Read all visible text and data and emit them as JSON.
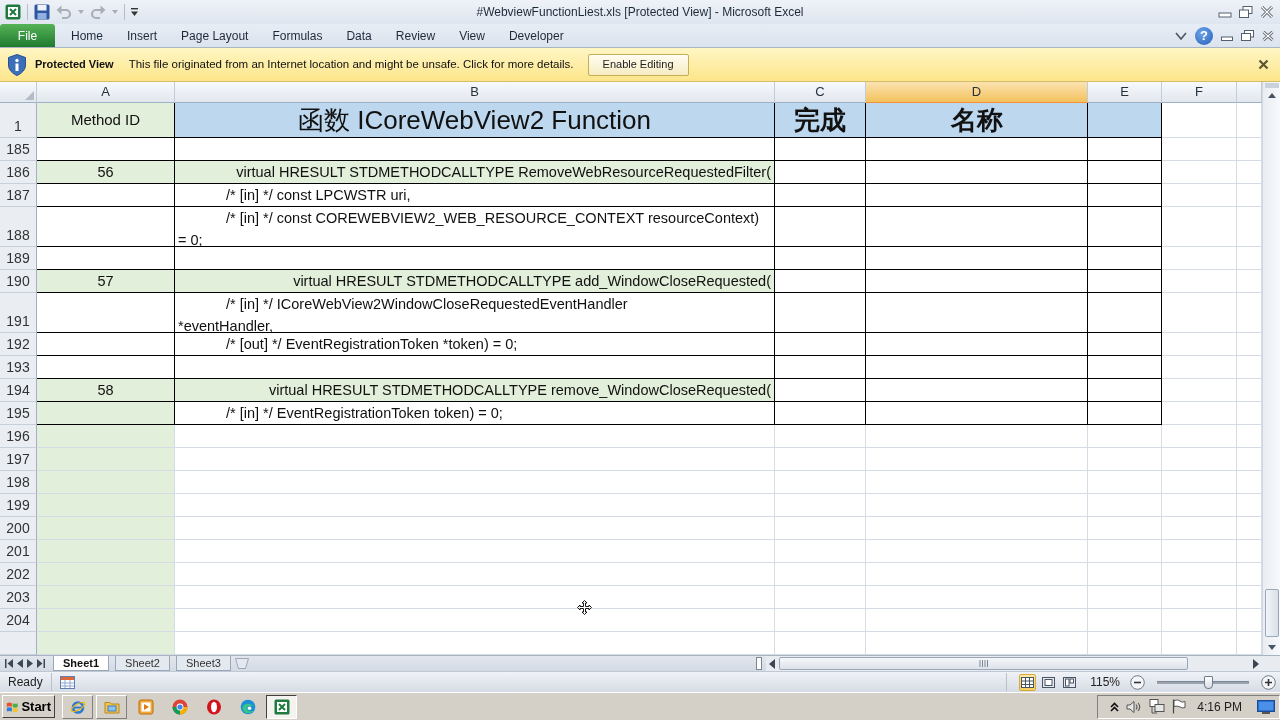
{
  "window": {
    "title": "#WebviewFunctionLiest.xls [Protected View] - Microsoft Excel"
  },
  "quick_access": [
    {
      "kind": "save",
      "disabled": false
    },
    {
      "kind": "undo",
      "disabled": true
    },
    {
      "kind": "redo",
      "disabled": true
    }
  ],
  "ribbon": {
    "tabs": [
      {
        "label": "File",
        "kind": "backstage"
      },
      {
        "label": "Home",
        "kind": "tab"
      },
      {
        "label": "Insert",
        "kind": "tab"
      },
      {
        "label": "Page Layout",
        "kind": "tab"
      },
      {
        "label": "Formulas",
        "kind": "tab"
      },
      {
        "label": "Data",
        "kind": "tab"
      },
      {
        "label": "Review",
        "kind": "tab"
      },
      {
        "label": "View",
        "kind": "tab"
      },
      {
        "label": "Developer",
        "kind": "tab"
      }
    ],
    "help": "?"
  },
  "message_bar": {
    "title": "Protected View",
    "message": "This file originated from an Internet location and might be unsafe. Click for more details.",
    "button": "Enable Editing"
  },
  "columns": [
    {
      "label": "A",
      "selected": false
    },
    {
      "label": "B",
      "selected": false
    },
    {
      "label": "C",
      "selected": false
    },
    {
      "label": "D",
      "selected": true
    },
    {
      "label": "E",
      "selected": false
    },
    {
      "label": "F",
      "selected": false
    }
  ],
  "rows": [
    {
      "number": "1",
      "kind": "heading",
      "cells": [
        {
          "text": "Method ID",
          "color": "#e2efda"
        },
        {
          "text": "函数 ICoreWebView2 Function",
          "color": "#bdd7ee"
        },
        {
          "text": "完成",
          "color": "#bdd7ee"
        },
        {
          "text": "名称",
          "color": "#bdd7ee"
        },
        {
          "color": "#bdd7ee"
        }
      ]
    },
    {
      "number": "185",
      "kind": "blank",
      "cells": []
    },
    {
      "number": "186",
      "kind": "method",
      "cells": [
        {
          "text": "56",
          "color": "#e2efda"
        },
        {
          "text": "virtual HRESULT STDMETHODCALLTYPE RemoveWebResourceRequestedFilter(",
          "color": "#e2efda"
        }
      ]
    },
    {
      "number": "187",
      "kind": "param",
      "cells": [
        {},
        {
          "text": "/* [in] */ const LPCWSTR uri,"
        }
      ]
    },
    {
      "number": "188",
      "kind": "param",
      "cells": [
        {},
        {
          "text": "/* [in] */ const COREWEBVIEW2_WEB_RESOURCE_CONTEXT resourceContext)\n= 0;"
        }
      ]
    },
    {
      "number": "189",
      "kind": "blank",
      "cells": []
    },
    {
      "number": "190",
      "kind": "method",
      "cells": [
        {
          "text": "57",
          "color": "#e2efda"
        },
        {
          "text": "virtual HRESULT STDMETHODCALLTYPE add_WindowCloseRequested(",
          "color": "#e2efda"
        }
      ]
    },
    {
      "number": "191",
      "kind": "param",
      "cells": [
        {},
        {
          "text": "/* [in] */ ICoreWebView2WindowCloseRequestedEventHandler\n*eventHandler,"
        }
      ]
    },
    {
      "number": "192",
      "kind": "param",
      "cells": [
        {},
        {
          "text": "/* [out] */ EventRegistrationToken *token) = 0;"
        }
      ]
    },
    {
      "number": "193",
      "kind": "blank",
      "cells": []
    },
    {
      "number": "194",
      "kind": "method",
      "cells": [
        {
          "text": "58",
          "color": "#e2efda"
        },
        {
          "text": "virtual HRESULT STDMETHODCALLTYPE remove_WindowCloseRequested(",
          "color": "#e2efda"
        }
      ]
    },
    {
      "number": "195",
      "kind": "param",
      "cells": [
        {
          "color": "#e2efda"
        },
        {
          "text": "/* [in] */ EventRegistrationToken token) = 0;"
        }
      ]
    },
    {
      "number": "196",
      "kind": "empty",
      "cells": [
        {
          "color": "#e2efda"
        }
      ]
    },
    {
      "number": "197",
      "kind": "empty",
      "cells": [
        {
          "color": "#e2efda"
        }
      ]
    },
    {
      "number": "198",
      "kind": "empty",
      "cells": [
        {
          "color": "#e2efda"
        }
      ]
    },
    {
      "number": "199",
      "kind": "empty",
      "cells": [
        {
          "color": "#e2efda"
        }
      ]
    },
    {
      "number": "200",
      "kind": "empty",
      "cells": [
        {
          "color": "#e2efda"
        }
      ]
    },
    {
      "number": "201",
      "kind": "empty",
      "cells": [
        {
          "color": "#e2efda"
        }
      ]
    },
    {
      "number": "202",
      "kind": "empty",
      "cells": [
        {
          "color": "#e2efda"
        }
      ]
    },
    {
      "number": "203",
      "kind": "empty",
      "cells": [
        {
          "color": "#e2efda"
        }
      ]
    },
    {
      "number": "204",
      "kind": "empty",
      "cells": [
        {
          "color": "#e2efda"
        }
      ]
    },
    {
      "kind": "empty",
      "cells": [
        {
          "color": "#e2efda"
        }
      ]
    }
  ],
  "sheet_tabs": [
    {
      "label": "Sheet1",
      "selected": true
    },
    {
      "label": "Sheet2",
      "selected": false
    },
    {
      "label": "Sheet3",
      "selected": false
    }
  ],
  "status_bar": {
    "status": "Ready",
    "views": [
      {
        "kind": "normal",
        "selected": true
      },
      {
        "kind": "page_layout",
        "selected": false
      },
      {
        "kind": "page_break",
        "selected": false
      }
    ],
    "zoom": {
      "reading": "115%",
      "level": 0.55
    }
  },
  "taskbar": {
    "start": "Start",
    "apps": [
      {
        "kind": "globe",
        "open": true,
        "selected": false
      },
      {
        "kind": "folder",
        "open": true,
        "selected": false
      },
      {
        "kind": "media",
        "open": false,
        "selected": false
      },
      {
        "kind": "segmented",
        "open": false,
        "selected": false
      },
      {
        "kind": "ring",
        "open": false,
        "selected": false
      },
      {
        "kind": "swirl",
        "open": false,
        "selected": false
      },
      {
        "kind": "sheet",
        "open": true,
        "selected": true
      }
    ],
    "clock": "4:16 PM"
  }
}
